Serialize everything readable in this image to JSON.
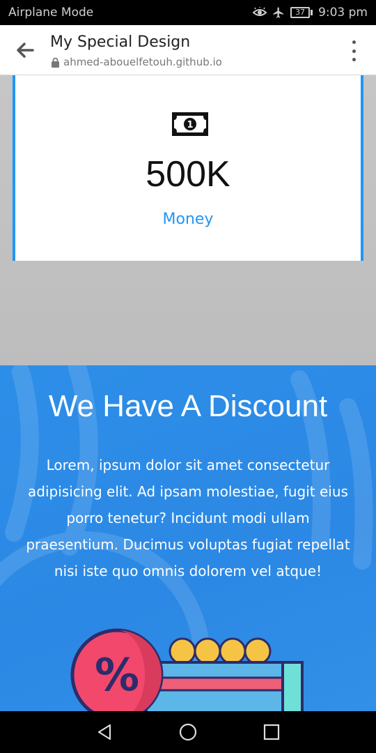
{
  "status_bar": {
    "carrier_text": "Airplane Mode",
    "battery_level": "37",
    "time": "9:03 pm",
    "icons": [
      "eye-comfort-icon",
      "airplane-icon",
      "battery-icon"
    ]
  },
  "browser": {
    "page_title": "My Special Design",
    "url": "ahmed-abouelfetouh.github.io",
    "icons": [
      "back-arrow-icon",
      "lock-icon",
      "more-vert-icon"
    ]
  },
  "stat": {
    "icon": "money-bill-icon",
    "value": "500K",
    "label": "Money"
  },
  "discount": {
    "title": "We Have A Discount",
    "text": "Lorem, ipsum dolor sit amet consectetur adipisicing elit. Ad ipsam molestiae, fugit eius porro tenetur? Incidunt modi ullam praesentium. Ducimus voluptas fugiat repellat nisi iste quo omnis dolorem vel atque!"
  },
  "nav_bar": {
    "icons": [
      "nav-back-icon",
      "nav-home-icon",
      "nav-recents-icon"
    ]
  },
  "colors": {
    "accent": "#2196f3",
    "discount_bg": "#2b88e4",
    "card_bg": "#ffffff",
    "page_gray": "#c2c2c2"
  }
}
